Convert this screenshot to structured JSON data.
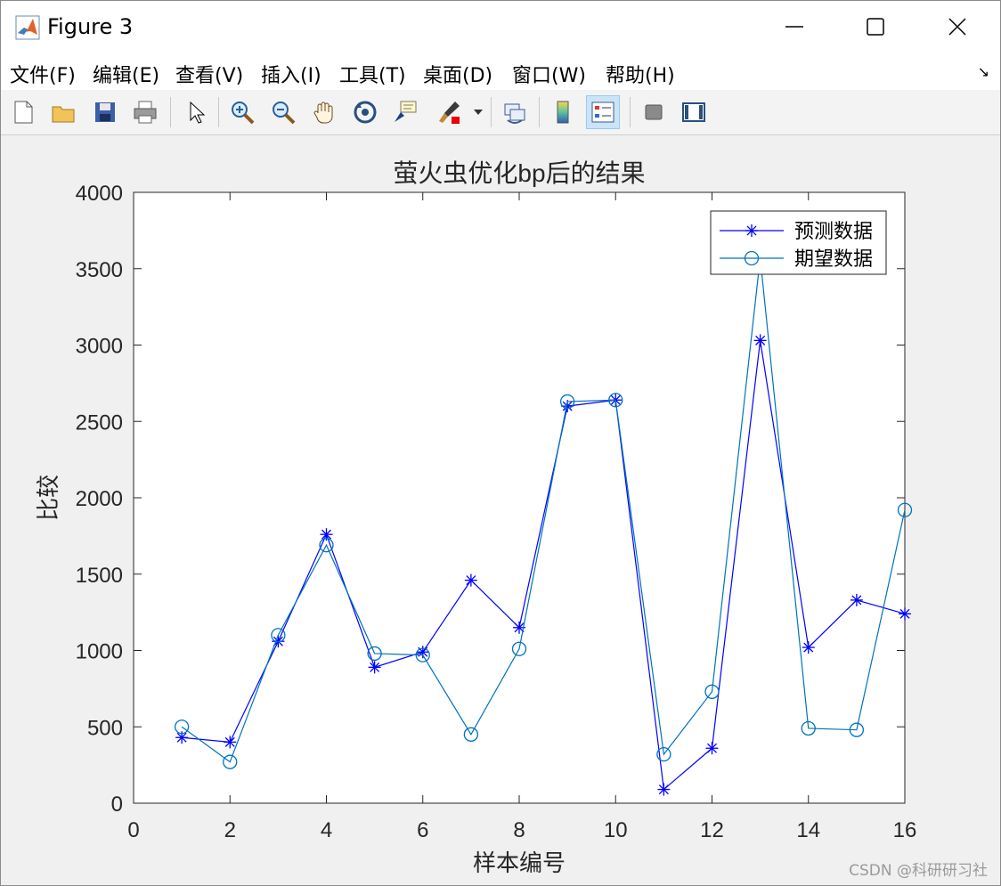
{
  "window": {
    "title": "Figure 3"
  },
  "menu": {
    "items": [
      "文件(F)",
      "编辑(E)",
      "查看(V)",
      "插入(I)",
      "工具(T)",
      "桌面(D)",
      "窗口(W)",
      "帮助(H)"
    ]
  },
  "toolbar": {
    "icons": [
      "new-file-icon",
      "open-folder-icon",
      "save-icon",
      "print-icon",
      "pointer-icon",
      "zoom-in-icon",
      "zoom-out-icon",
      "pan-hand-icon",
      "rotate-3d-icon",
      "data-cursor-icon",
      "brush-icon",
      "link-plot-icon",
      "colorbar-icon",
      "legend-icon",
      "hide-plot-tools-icon",
      "show-plot-tools-icon"
    ]
  },
  "colors": {
    "series1": "#0000ff",
    "series2": "#0072bd"
  },
  "watermark": "CSDN @科研研习社",
  "chart_data": {
    "type": "line",
    "title": "萤火虫优化bp后的结果",
    "xlabel": "样本编号",
    "ylabel": "比较",
    "xlim": [
      0,
      16
    ],
    "ylim": [
      0,
      4000
    ],
    "xticks": [
      0,
      2,
      4,
      6,
      8,
      10,
      12,
      14,
      16
    ],
    "yticks": [
      0,
      500,
      1000,
      1500,
      2000,
      2500,
      3000,
      3500,
      4000
    ],
    "grid": false,
    "legend_position": "top-right",
    "x": [
      1,
      2,
      3,
      4,
      5,
      6,
      7,
      8,
      9,
      10,
      11,
      12,
      13,
      14,
      15,
      16
    ],
    "series": [
      {
        "name": "预测数据",
        "marker": "asterisk",
        "color": "#0000ff",
        "values": [
          430,
          400,
          1060,
          1760,
          890,
          990,
          1460,
          1150,
          2600,
          2640,
          90,
          360,
          3030,
          1020,
          1330,
          1240
        ]
      },
      {
        "name": "期望数据",
        "marker": "circle",
        "color": "#0072bd",
        "values": [
          500,
          270,
          1100,
          1690,
          980,
          970,
          450,
          1010,
          2630,
          2640,
          320,
          730,
          3570,
          490,
          480,
          1920
        ]
      }
    ]
  }
}
